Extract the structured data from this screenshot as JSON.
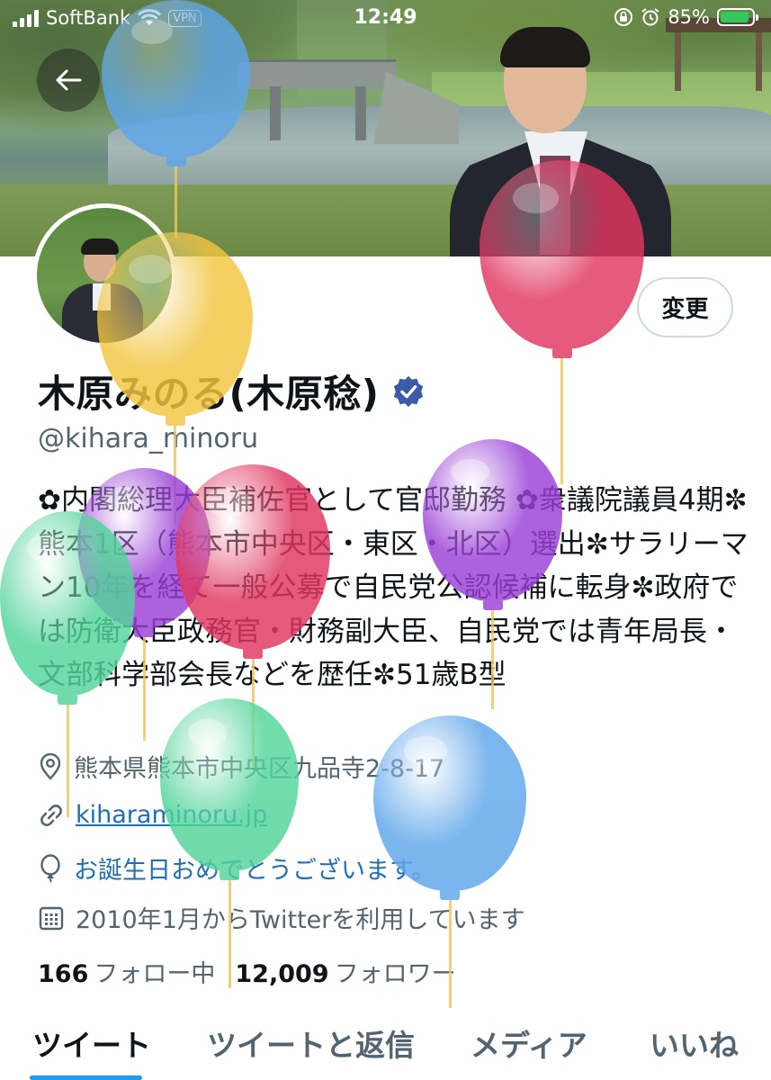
{
  "status_bar": {
    "carrier": "SoftBank",
    "vpn": "VPN",
    "time": "12:49",
    "battery_percent": "85%",
    "battery_level": 0.85,
    "battery_color": "#34c759"
  },
  "header": {
    "back_icon": "arrow-left-icon",
    "banner": "photo of a river park with a man in a suit"
  },
  "profile": {
    "edit_button": "変更",
    "display_name": "木原みのる(木原稔)",
    "verified_icon": "verified-badge-icon",
    "verified_color": "#3b5ba9",
    "handle": "@kihara_minoru",
    "bio": "✿内閣総理大臣補佐官として官邸勤務 ✿衆議院議員4期✼ 熊本1区（熊本市中央区・東区・北区）選出✼サラリーマン10年を経て一般公募で自民党公認候補に転身✼政府では防衛大臣政務官・財務副大臣、自民党では青年局長・文部科学部会長などを歴任✼51歳B型",
    "location": "熊本県熊本市中央区九品寺2-8-17",
    "website": "kiharaminoru.jp",
    "birthday": "お誕生日おめでとうございます。",
    "joined": "2010年1月からTwitterを利用しています",
    "following_count": "166",
    "following_label": "フォロー中",
    "followers_count": "12,009",
    "followers_label": "フォロワー"
  },
  "tabs": [
    {
      "label": "ツイート",
      "active": true
    },
    {
      "label": "ツイートと返信",
      "active": false
    },
    {
      "label": "メディア",
      "active": false
    },
    {
      "label": "いいね",
      "active": false
    }
  ],
  "colors": {
    "accent": "#1d9bf0",
    "link": "#1d6fb8",
    "balloon_blue": "#5fa6ea",
    "balloon_red": "#e0365f",
    "balloon_yellow": "#f2c53f",
    "balloon_purple": "#9a3fd6",
    "balloon_green": "#52d49a"
  }
}
